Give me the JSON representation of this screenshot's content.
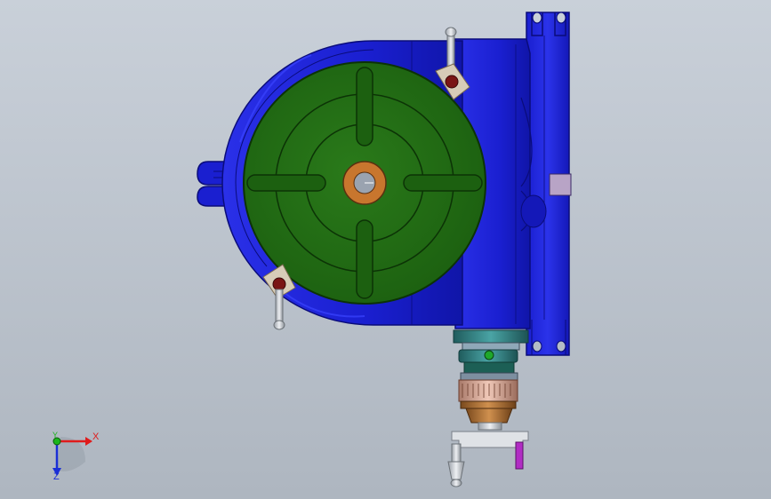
{
  "triad": {
    "x_label": "X",
    "y_label": "Y",
    "z_label": "Z",
    "x_color": "#e01b1b",
    "y_color": "#1bb51b",
    "z_color": "#1b2fd6"
  },
  "colors": {
    "background_top": "#c9d0d9",
    "background_bottom": "#aeb6c0",
    "housing": "#1a1fd0",
    "housing_edge": "#0a0c7a",
    "table": "#1f6b12",
    "table_edge": "#0c3306",
    "bore": "#c8762e",
    "handwheel_bronze": "#b8763a",
    "collar_teal": "#2f7f80"
  }
}
